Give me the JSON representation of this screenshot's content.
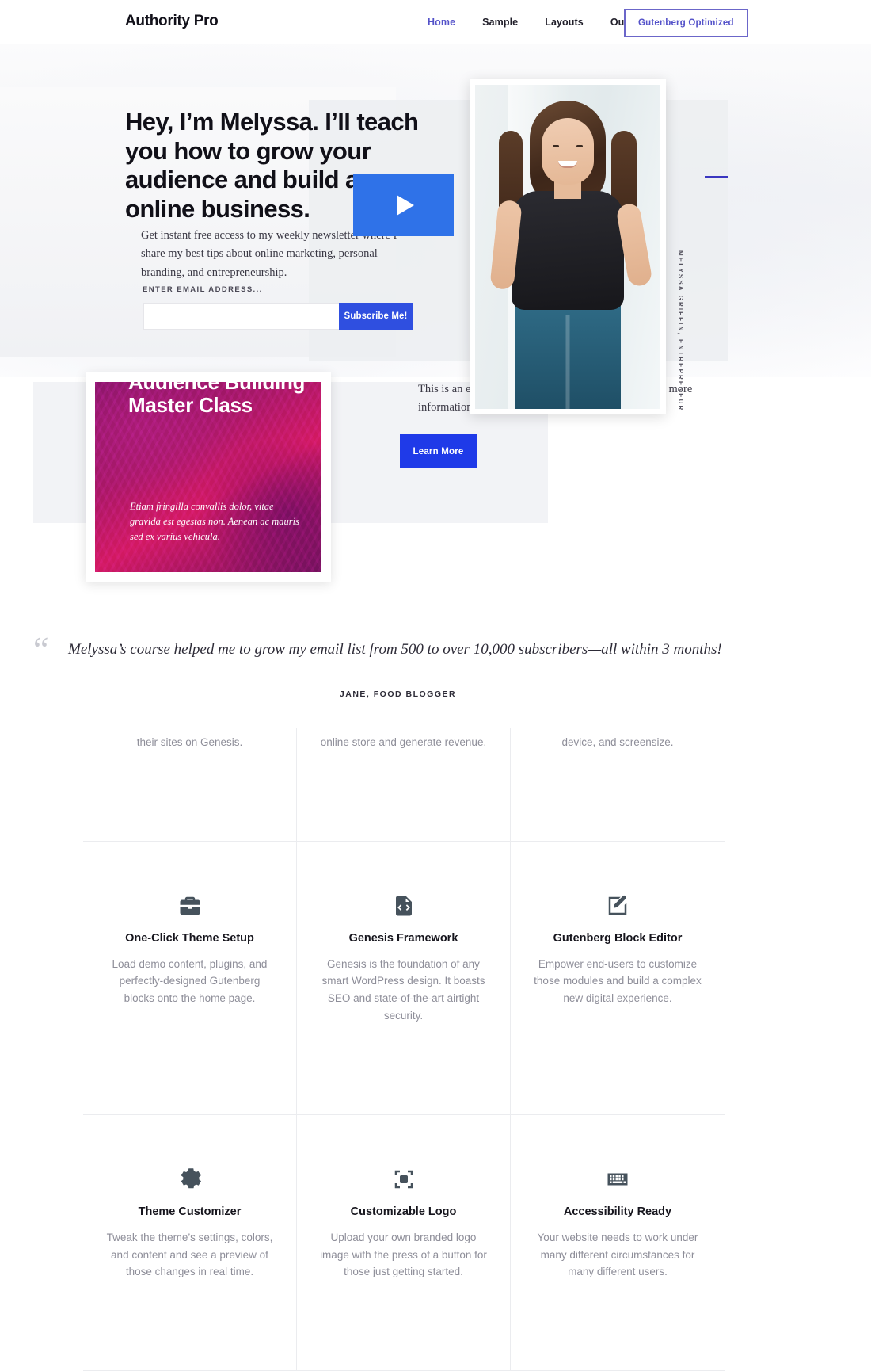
{
  "header": {
    "brand": "Authority Pro",
    "nav": [
      {
        "label": "Home",
        "active": true
      },
      {
        "label": "Sample",
        "active": false
      },
      {
        "label": "Layouts",
        "active": false
      },
      {
        "label": "Our Shop",
        "active": false
      }
    ],
    "cta_label": "Gutenberg Optimized",
    "accent_color": "#5452c9"
  },
  "hero": {
    "headline": "Hey, I’m Melyssa. I’ll teach you how to grow your audience and build an online business.",
    "subtext": "Get instant free access to my weekly newsletter where I share my best tips about online marketing, personal branding, and entrepreneurship.",
    "form_label": "ENTER EMAIL ADDRESS...",
    "email_placeholder": "",
    "email_value": "",
    "subscribe_label": "Subscribe Me!",
    "photo_caption": "MELYSSA GRIFFIN, ENTREPRENEUR",
    "play_icon": "play-icon",
    "button_color": "#2f4fe0",
    "play_color": "#2f72e8"
  },
  "course": {
    "title": "Audience Building Master Class",
    "description": "Etiam fringilla convallis dolor, vitae gravida est egestas non. Aenean ac mauris sed ex varius vehicula.",
    "body_text": "This is an example of a paragraph, you could also add more information about yourself so or your business.",
    "learn_more_label": "Learn More",
    "button_color": "#1f3ae8"
  },
  "testimonial": {
    "quote_icon": "quote-icon",
    "quote": "Melyssa’s course helped me to grow my email list from 500 to over 10,000 subscribers—all within 3 months!",
    "cite": "JANE, FOOD BLOGGER"
  },
  "features": {
    "partial_row": [
      {
        "text": "their sites on Genesis."
      },
      {
        "text": "online store and generate revenue."
      },
      {
        "text": "device, and screensize."
      }
    ],
    "items": [
      {
        "icon": "briefcase-icon",
        "title": "One-Click Theme Setup",
        "desc": "Load demo content, plugins, and perfectly-designed Gutenberg blocks onto the home page."
      },
      {
        "icon": "code-file-icon",
        "title": "Genesis Framework",
        "desc": "Genesis is the foundation of any smart WordPress design. It boasts SEO and state-of-the-art airtight security."
      },
      {
        "icon": "edit-pencil-icon",
        "title": "Gutenberg Block Editor",
        "desc": "Empower end-users to customize those modules and build a complex new digital experience."
      },
      {
        "icon": "gear-icon",
        "title": "Theme Customizer",
        "desc": "Tweak the theme’s settings, colors, and content and see a preview of those changes in real time."
      },
      {
        "icon": "crop-logo-icon",
        "title": "Customizable Logo",
        "desc": "Upload your own branded logo image with the press of a button for those just getting started."
      },
      {
        "icon": "keyboard-icon",
        "title": "Accessibility Ready",
        "desc": "Your website needs to work under many different circumstances for many different users."
      }
    ]
  }
}
